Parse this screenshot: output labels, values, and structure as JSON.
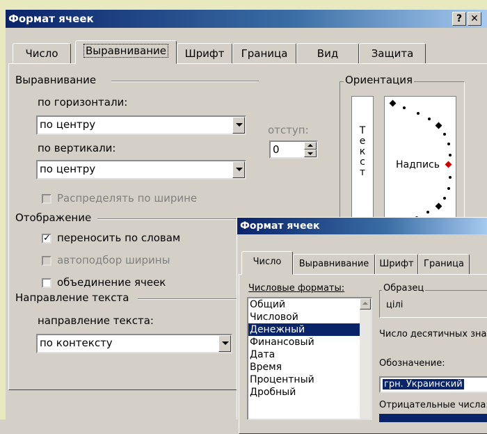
{
  "main_dialog": {
    "title": "Формат ячеек",
    "help_btn": "?",
    "close_btn": "✕",
    "tabs": [
      "Число",
      "Выравнивание",
      "Шрифт",
      "Граница",
      "Вид",
      "Защита"
    ],
    "active_tab": "Выравнивание",
    "alignment_group": "Выравнивание",
    "horizontal_label": "по горизонтали:",
    "horizontal_value": "по центру",
    "indent_label": "отступ:",
    "indent_value": "0",
    "vertical_label": "по вертикали:",
    "vertical_value": "по центру",
    "distribute_label": "Распределять по ширине",
    "orientation_group": "Ориентация",
    "vertical_text_letters": [
      "Т",
      "е",
      "к",
      "с",
      "т"
    ],
    "orientation_caption": "Надпись",
    "display_group": "Отображение",
    "wrap_label": "переносить по словам",
    "wrap_checked": true,
    "autofit_label": "автоподбор ширины",
    "merge_label": "объединение ячеек",
    "direction_group": "Направление текста",
    "direction_label": "направление текста:",
    "direction_value": "по контексту"
  },
  "second_dialog": {
    "title": "Формат ячеек",
    "tabs": [
      "Число",
      "Выравнивание",
      "Шрифт",
      "Граница"
    ],
    "active_tab": "Число",
    "formats_label": "Числовые форматы:",
    "formats": [
      "Общий",
      "Числовой",
      "Денежный",
      "Финансовый",
      "Дата",
      "Время",
      "Процентный",
      "Дробный"
    ],
    "selected_format": "Денежный",
    "sample_group": "Образец",
    "sample_value": "цілі",
    "decimals_label": "Число десятичных зна",
    "symbol_label": "Обозначение:",
    "symbol_value": "грн. Украинский",
    "negative_label": "Отрицательные числа:"
  },
  "colors": {
    "title_start": "#0a246a",
    "title_end": "#a6caf0",
    "selection": "#0a246a",
    "background_deco": "#e9e9c0",
    "orientation_dot": "#cc0000"
  }
}
